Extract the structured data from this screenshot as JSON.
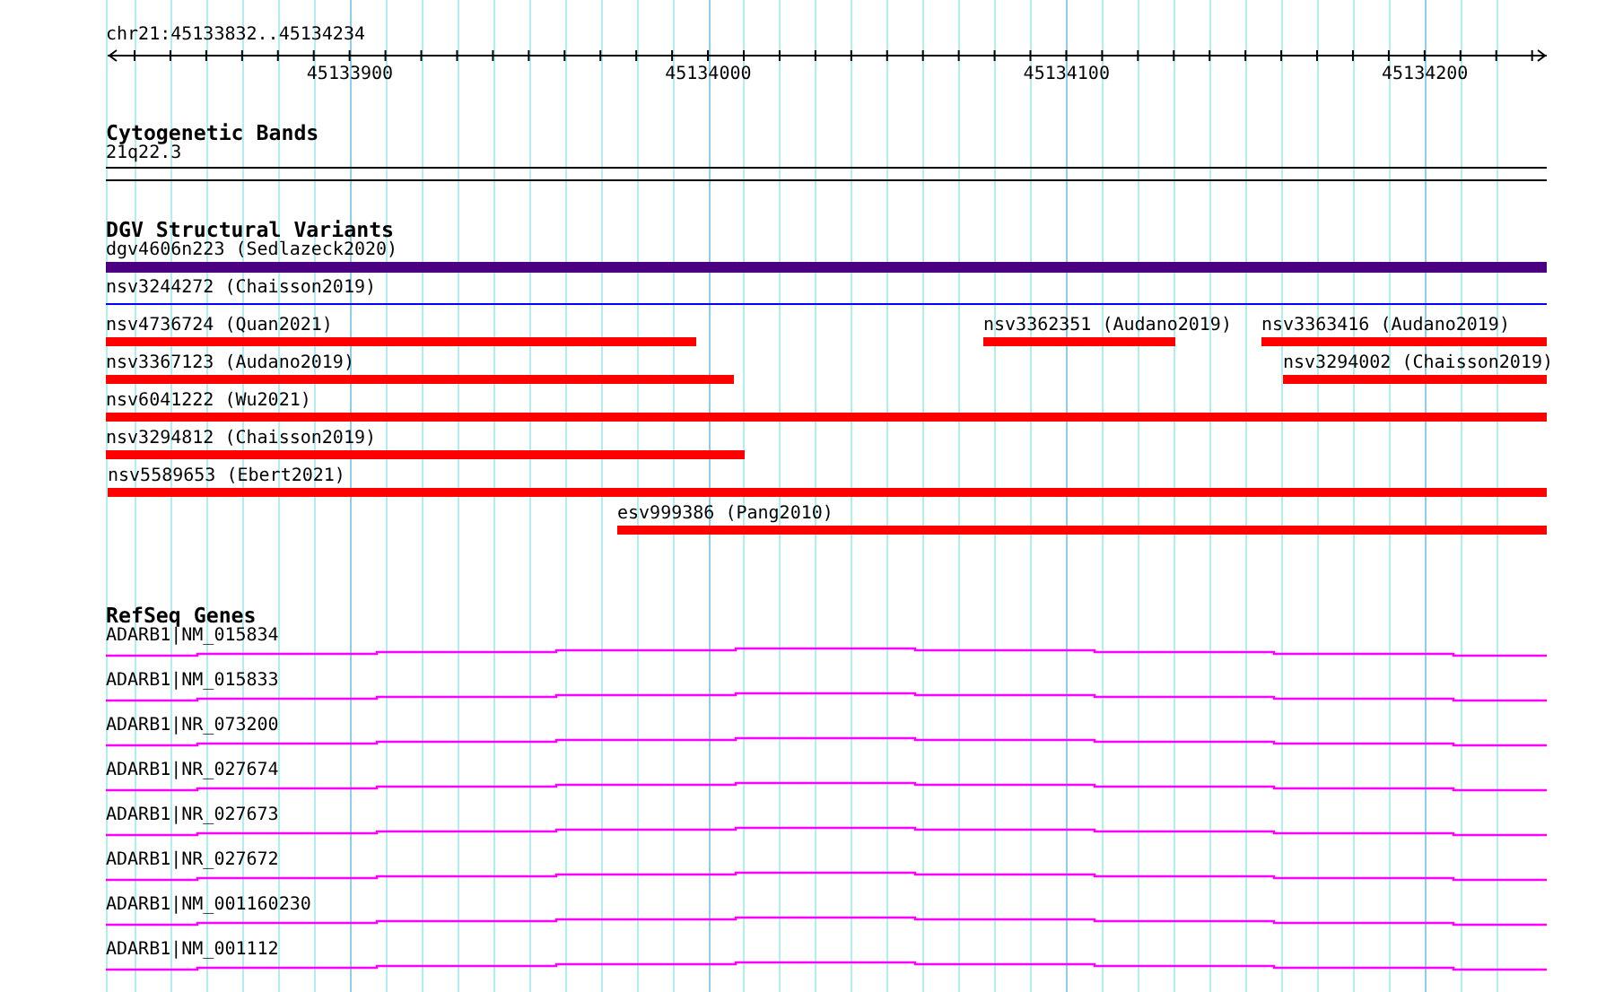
{
  "location": "chr21:45133832..45134234",
  "ruler": {
    "ticks": [
      "45133900",
      "45134000",
      "45134100",
      "45134200"
    ]
  },
  "tracks": [
    {
      "kind": "bands",
      "title": "Cytogenetic Bands",
      "features": [
        {
          "label": "21q22.3"
        }
      ]
    },
    {
      "kind": "variants",
      "title": "DGV Structural Variants",
      "rows": [
        {
          "features": [
            {
              "label": "dgv4606n223 (Sedlazeck2020)",
              "kind": "thick",
              "color": "#4b0082"
            }
          ]
        },
        {
          "features": [
            {
              "label": "nsv3244272 (Chaisson2019)",
              "kind": "line",
              "color": "#0000ff"
            }
          ]
        },
        {
          "features": [
            {
              "label": "nsv4736724 (Quan2021)",
              "kind": "bar",
              "color": "#ff0000"
            },
            {
              "label": "nsv3362351 (Audano2019)",
              "kind": "bar",
              "color": "#ff0000"
            },
            {
              "label": "nsv3363416 (Audano2019)",
              "kind": "bar",
              "color": "#ff0000"
            }
          ]
        },
        {
          "features": [
            {
              "label": "nsv3367123 (Audano2019)",
              "kind": "bar",
              "color": "#ff0000"
            },
            {
              "label": "nsv3294002 (Chaisson2019)",
              "kind": "bar",
              "color": "#ff0000"
            }
          ]
        },
        {
          "features": [
            {
              "label": "nsv6041222 (Wu2021)",
              "kind": "bar",
              "color": "#ff0000"
            }
          ]
        },
        {
          "features": [
            {
              "label": "nsv3294812 (Chaisson2019)",
              "kind": "bar",
              "color": "#ff0000"
            }
          ]
        },
        {
          "features": [
            {
              "label": "nsv5589653 (Ebert2021)",
              "kind": "bar",
              "color": "#ff0000"
            }
          ]
        },
        {
          "features": [
            {
              "label": "esv999386 (Pang2010)",
              "kind": "bar",
              "color": "#ff0000"
            }
          ]
        }
      ]
    },
    {
      "kind": "genes",
      "title": "RefSeq Genes",
      "genes": [
        {
          "label": "ADARB1|NM_015834"
        },
        {
          "label": "ADARB1|NM_015833"
        },
        {
          "label": "ADARB1|NR_073200"
        },
        {
          "label": "ADARB1|NR_027674"
        },
        {
          "label": "ADARB1|NR_027673"
        },
        {
          "label": "ADARB1|NR_027672"
        },
        {
          "label": "ADARB1|NM_001160230"
        },
        {
          "label": "ADARB1|NM_001112"
        }
      ]
    }
  ]
}
